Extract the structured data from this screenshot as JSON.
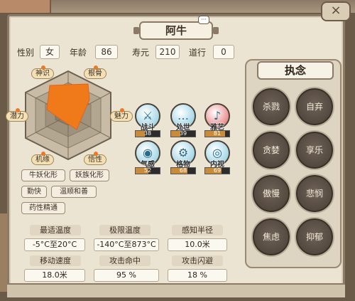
{
  "header": {
    "name": "阿牛",
    "close_icon": "×",
    "chat_icon": "···"
  },
  "stats": {
    "gender_label": "性别",
    "gender": "女",
    "age_label": "年龄",
    "age": "86",
    "lifespan_label": "寿元",
    "lifespan": "210",
    "dao_label": "道行",
    "dao": "0"
  },
  "attributes": {
    "shenshi": "神识",
    "gengu": "根骨",
    "meili": "魅力",
    "wuxing": "悟性",
    "jiyuan": "机缘",
    "qianli": "潜力"
  },
  "skills": [
    {
      "label": "战斗",
      "value": "38",
      "fill": 0.38,
      "glyph": "⚔",
      "color": "#7fc6dc"
    },
    {
      "label": "处世",
      "value": "39",
      "fill": 0.39,
      "glyph": "…",
      "color": "#7fc6dc"
    },
    {
      "label": "雅艺",
      "value": "81",
      "fill": 0.81,
      "glyph": "♪",
      "color": "#e06060"
    },
    {
      "label": "气感",
      "value": "52",
      "fill": 0.52,
      "glyph": "◉",
      "color": "#7fc6dc"
    },
    {
      "label": "格物",
      "value": "68",
      "fill": 0.68,
      "glyph": "⚙",
      "color": "#7fc6dc"
    },
    {
      "label": "内视",
      "value": "69",
      "fill": 0.69,
      "glyph": "◎",
      "color": "#7fc6dc"
    }
  ],
  "tags": [
    "牛妖化形",
    "妖族化形",
    "勤快",
    "温顺和善",
    "药性精通"
  ],
  "obsessions": {
    "title": "执念",
    "items": [
      "杀戮",
      "自弃",
      "贪婪",
      "享乐",
      "傲慢",
      "悲悯",
      "焦虑",
      "抑郁"
    ]
  },
  "details": {
    "best_temp_label": "最适温度",
    "best_temp": "-5°C至20°C",
    "limit_temp_label": "极限温度",
    "limit_temp": "-140°C至873°C",
    "sense_label": "感知半径",
    "sense": "10.0米",
    "move_label": "移动速度",
    "move": "18.0米",
    "hit_label": "攻击命中",
    "hit": "95 %",
    "dodge_label": "攻击闪避",
    "dodge": "18 %"
  },
  "colors": {
    "radar_fill": "#f07a1a",
    "radar_ring": "#a89a86"
  }
}
